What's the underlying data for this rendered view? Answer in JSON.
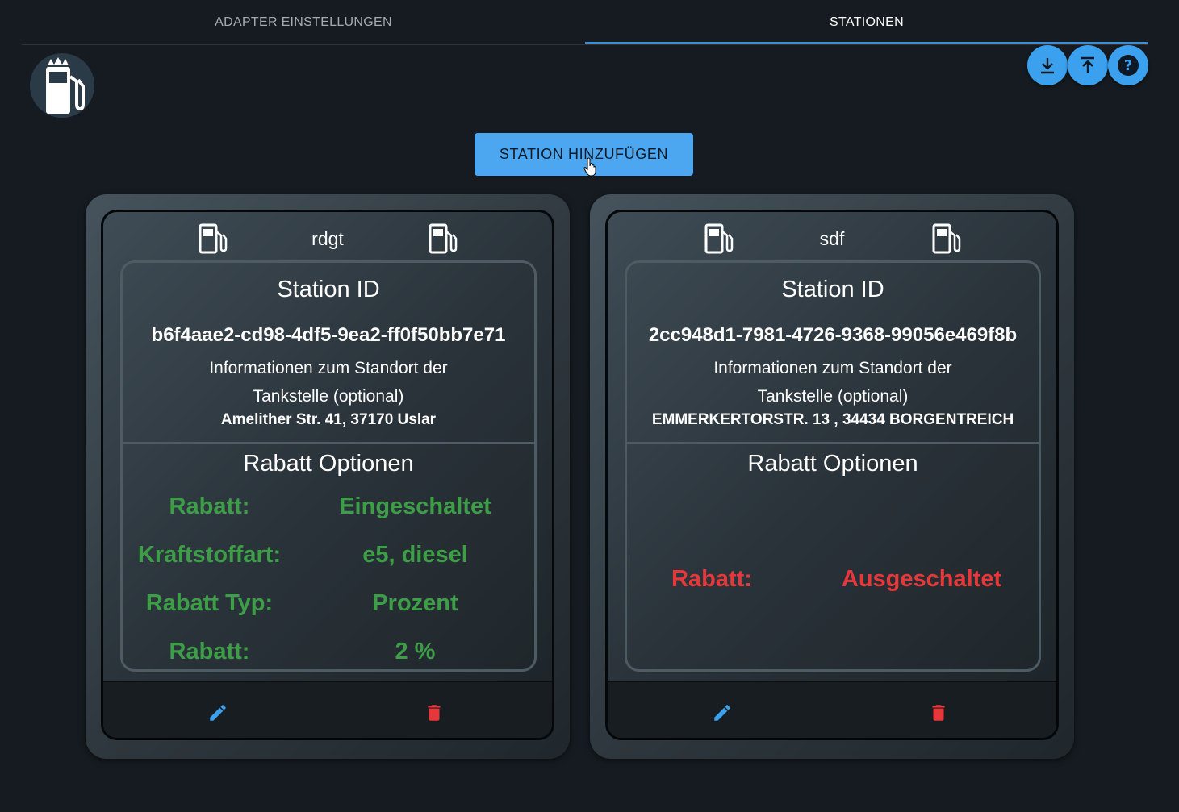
{
  "tabs": [
    {
      "label": "ADAPTER EINSTELLUNGEN"
    },
    {
      "label": "STATIONEN"
    }
  ],
  "toolbar": {
    "icons": [
      "download-icon",
      "upload-icon",
      "help-icon"
    ],
    "accent_color": "#3ba1ef"
  },
  "add_button": {
    "label": "STATION HINZUFÜGEN"
  },
  "stations": [
    {
      "name": "rdgt",
      "station_id_label": "Station ID",
      "station_id": "b6f4aae2-cd98-4df5-9ea2-ff0f50bb7e71",
      "location_label": "Informationen zum Standort der Tankstelle (optional)",
      "location": "Amelither Str. 41, 37170 Uslar",
      "rabatt_title": "Rabatt Optionen",
      "status_color": "#3e9e48",
      "rows": [
        {
          "key": "Rabatt:",
          "value": "Eingeschaltet"
        },
        {
          "key": "Kraftstoffart:",
          "value": "e5, diesel"
        },
        {
          "key": "Rabatt Typ:",
          "value": "Prozent"
        },
        {
          "key": "Rabatt:",
          "value": "2 %"
        }
      ]
    },
    {
      "name": "sdf",
      "station_id_label": "Station ID",
      "station_id": "2cc948d1-7981-4726-9368-99056e469f8b",
      "location_label": "Informationen zum Standort der Tankstelle (optional)",
      "location": "EMMERKERTORSTR. 13 , 34434 BORGENTREICH",
      "rabatt_title": "Rabatt Optionen",
      "status_color": "#e6383a",
      "rows": [
        {
          "key": "Rabatt:",
          "value": "Ausgeschaltet"
        }
      ]
    }
  ]
}
